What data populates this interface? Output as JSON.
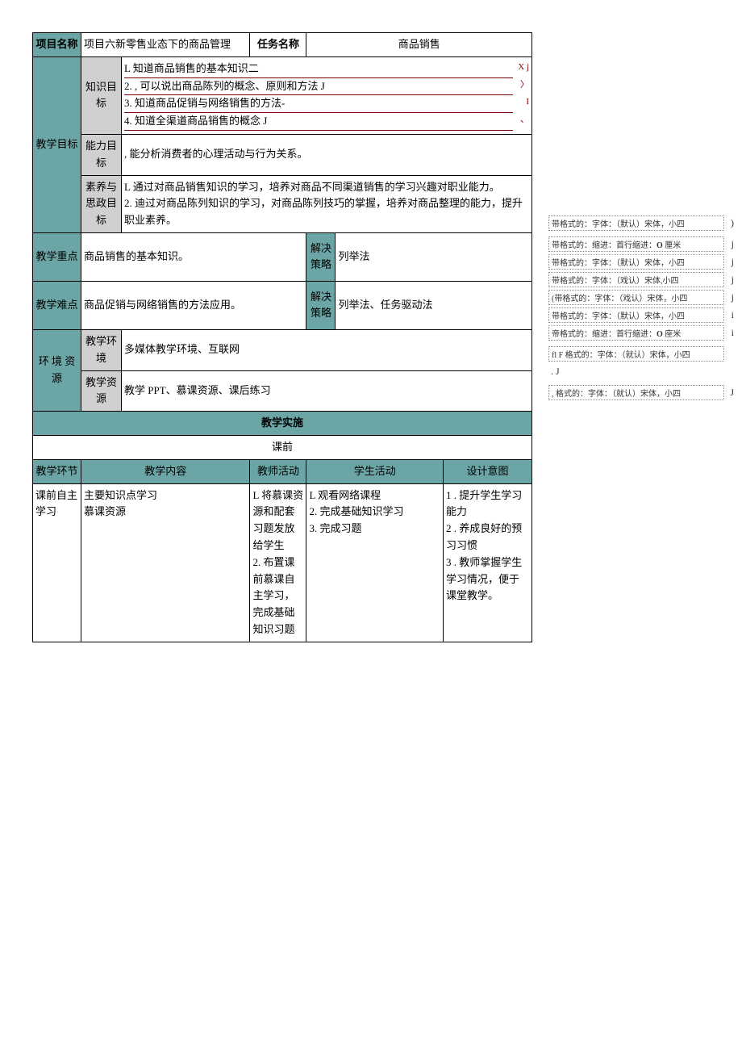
{
  "header": {
    "project_name_label": "项目名称",
    "project_name_value": "项目六新零售业态下的商品管理",
    "task_name_label": "任务名称",
    "task_name_value": "商品销售"
  },
  "goals": {
    "section_label": "教学目标",
    "knowledge": {
      "label": "知识目标",
      "items": [
        {
          "text": "L 知道商品销售的基本知识二",
          "mark": "X j"
        },
        {
          "text": "2. , 可以说出商品陈列的概念、原则和方法 J",
          "mark": "〉"
        },
        {
          "text": "3. 知道商品促销与网络销售的方法-",
          "mark": "I"
        },
        {
          "text": "4. 知道全渠道商品销售的概念 J",
          "mark": "、"
        }
      ]
    },
    "ability": {
      "label": "能力目标",
      "text": ", 能分析消费者的心理活动与行为关系。"
    },
    "literacy": {
      "label": "素养与思政目标",
      "text": "L 通过对商品销售知识的学习，培养对商品不同渠道销售的学习兴趣对职业能力。\n2. 迪过对商品陈列知识的学习，对商品陈列技巧的掌握，培养对商品整理的能力，提升职业素养。"
    }
  },
  "keypoint": {
    "label": "教学重点",
    "text": "商品销售的基本知识。",
    "strategy_label": "解决策略",
    "strategy_text": "列举法"
  },
  "difficulty": {
    "label": "教学难点",
    "text": "商品促销与网络销售的方法应用。",
    "strategy_label": "解决策略",
    "strategy_text": "列举法、任务驱动法"
  },
  "env": {
    "label": "环 境 资源",
    "env_label": "教学环境",
    "env_text": "多媒体教学环境、互联网",
    "res_label": "教学资源",
    "res_text": "教学 PPT、慕课资源、课后练习"
  },
  "impl": {
    "section_label": "教学实施",
    "pre_label": "课前",
    "cols": {
      "c1": "教学环节",
      "c2": "教学内容",
      "c3": "教师活动",
      "c4": "学生活动",
      "c5": "设计意图"
    },
    "row": {
      "c1": "课前自主学习",
      "c2": "主要知识点学习\n慕课资源",
      "c3": "L 将慕课资源和配套习题发放给学生\n2. 布置课前慕课自主学习，完成基础知识习题",
      "c4": "L 观看网络课程\n2. 完成基础知识学习\n3. 完成习题",
      "c5": "1   . 提升学生学习能力\n2   . 养成良好的预习习惯\n3   . 教师掌握学生学习情况，便于课堂教学。"
    }
  },
  "comments": [
    {
      "text": "带格式的：字体：（默认）宋体，小四",
      "tail": ")"
    },
    {
      "text": "带格式的：缩进：首行缩进：O 厘米",
      "tail": "j",
      "o": true
    },
    {
      "text": "带格式的：字体：（默认）宋体，小四",
      "tail": "j",
      "strike": true
    },
    {
      "text": "带格式的：字体：（戏认）宋体,小四",
      "tail": "j"
    },
    {
      "text": "(带格式的：字体：（戏认）宋体，小四",
      "tail": "j"
    },
    {
      "text": "带格式的：字体：（默认）宋体，小四",
      "tail": "i"
    },
    {
      "text": "帝格式的：缩进：首行缩进：O 座米",
      "tail": "i",
      "o": true,
      "strike": true
    },
    {
      "text": "fl F 格式的：字体：（就认）宋体，小四",
      "tail": ""
    },
    {
      "text": ". J",
      "tail": "",
      "plain": true
    },
    {
      "text": ", 格式的：字体：（就认）宋体，小四",
      "tail": "J"
    }
  ]
}
